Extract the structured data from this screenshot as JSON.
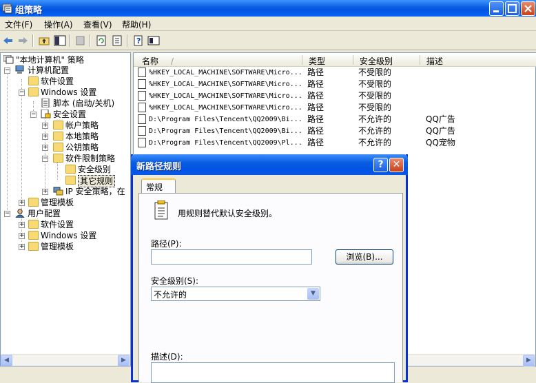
{
  "window": {
    "title": "组策略"
  },
  "menu": [
    {
      "label": "文件(F)"
    },
    {
      "label": "操作(A)"
    },
    {
      "label": "查看(V)"
    },
    {
      "label": "帮助(H)"
    }
  ],
  "tree": [
    {
      "label": "\"本地计算机\" 策略"
    },
    {
      "label": "计算机配置"
    },
    {
      "label": "软件设置"
    },
    {
      "label": "Windows 设置"
    },
    {
      "label": "脚本 (启动/关机)"
    },
    {
      "label": "安全设置"
    },
    {
      "label": "帐户策略"
    },
    {
      "label": "本地策略"
    },
    {
      "label": "公钥策略"
    },
    {
      "label": "软件限制策略"
    },
    {
      "label": "安全级别"
    },
    {
      "label": "其它规则"
    },
    {
      "label": "IP 安全策略，在"
    },
    {
      "label": "管理模板"
    },
    {
      "label": "用户配置"
    },
    {
      "label": "软件设置"
    },
    {
      "label": "Windows 设置"
    },
    {
      "label": "管理模板"
    }
  ],
  "list": {
    "columns": [
      "名称",
      "类型",
      "安全级别",
      "描述"
    ],
    "sort_indicator": "/",
    "rows": [
      {
        "name": "%HKEY_LOCAL_MACHINE\\SOFTWARE\\Micro...",
        "type": "路径",
        "level": "不受限的",
        "desc": ""
      },
      {
        "name": "%HKEY_LOCAL_MACHINE\\SOFTWARE\\Micro...",
        "type": "路径",
        "level": "不受限的",
        "desc": ""
      },
      {
        "name": "%HKEY_LOCAL_MACHINE\\SOFTWARE\\Micro...",
        "type": "路径",
        "level": "不受限的",
        "desc": ""
      },
      {
        "name": "%HKEY_LOCAL_MACHINE\\SOFTWARE\\Micro...",
        "type": "路径",
        "level": "不受限的",
        "desc": ""
      },
      {
        "name": "D:\\Program Files\\Tencent\\QQ2009\\Bi...",
        "type": "路径",
        "level": "不允许的",
        "desc": "QQ广告"
      },
      {
        "name": "D:\\Program Files\\Tencent\\QQ2009\\Bi...",
        "type": "路径",
        "level": "不允许的",
        "desc": "QQ广告"
      },
      {
        "name": "D:\\Program Files\\Tencent\\QQ2009\\Pl...",
        "type": "路径",
        "level": "不允许的",
        "desc": "QQ宠物"
      }
    ]
  },
  "dialog": {
    "title": "新路径规则",
    "help_label": "?",
    "close_label": "✕",
    "tab": "常规",
    "intro": "用规则替代默认安全级别。",
    "path_label": "路径(P):",
    "path_value": "",
    "browse_label": "浏览(B)...",
    "level_label": "安全级别(S):",
    "level_value": "不允许的",
    "desc_label": "描述(D):",
    "desc_value": ""
  },
  "colors": {
    "title_blue": "#0054e3",
    "close_red": "#c8411b",
    "highlight_tab": "#ffc83c"
  }
}
